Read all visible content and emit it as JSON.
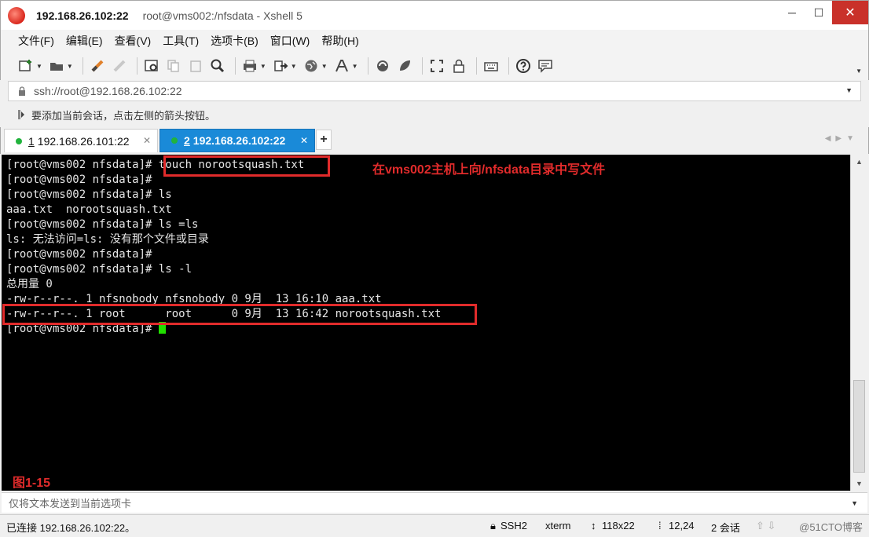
{
  "window": {
    "host_title": "192.168.26.102:22",
    "subtitle": "root@vms002:/nfsdata - Xshell 5",
    "minimize": "─",
    "maximize": "☐",
    "close": "✕"
  },
  "menu": [
    "文件(F)",
    "编辑(E)",
    "查看(V)",
    "工具(T)",
    "选项卡(B)",
    "窗口(W)",
    "帮助(H)"
  ],
  "address": {
    "value": "ssh://root@192.168.26.102:22"
  },
  "hint": "要添加当前会话，点击左侧的箭头按钮。",
  "tabs": [
    {
      "num": "1",
      "label": "192.168.26.101:22"
    },
    {
      "num": "2",
      "label": "192.168.26.102:22"
    }
  ],
  "tab_add": "+",
  "terminal": {
    "lines": [
      "[root@vms002 nfsdata]# touch norootsquash.txt",
      "[root@vms002 nfsdata]#",
      "[root@vms002 nfsdata]# ls",
      "aaa.txt  norootsquash.txt",
      "[root@vms002 nfsdata]# ls =ls",
      "ls: 无法访问=ls: 没有那个文件或目录",
      "[root@vms002 nfsdata]#",
      "[root@vms002 nfsdata]# ls -l",
      "总用量 0",
      "-rw-r--r--. 1 nfsnobody nfsnobody 0 9月  13 16:10 aaa.txt",
      "-rw-r--r--. 1 root      root      0 9月  13 16:42 norootsquash.txt",
      "[root@vms002 nfsdata]# "
    ],
    "annotation": "在vms002主机上向/nfsdata目录中写文件",
    "figure_label": "图1-15"
  },
  "compose": "仅将文本发送到当前选项卡",
  "status": {
    "connection": "已连接 192.168.26.102:22。",
    "protocol": "SSH2",
    "term": "xterm",
    "size": "118x22",
    "position": "12,24",
    "sessions": "2 会话",
    "watermark": "@51CTO博客"
  }
}
